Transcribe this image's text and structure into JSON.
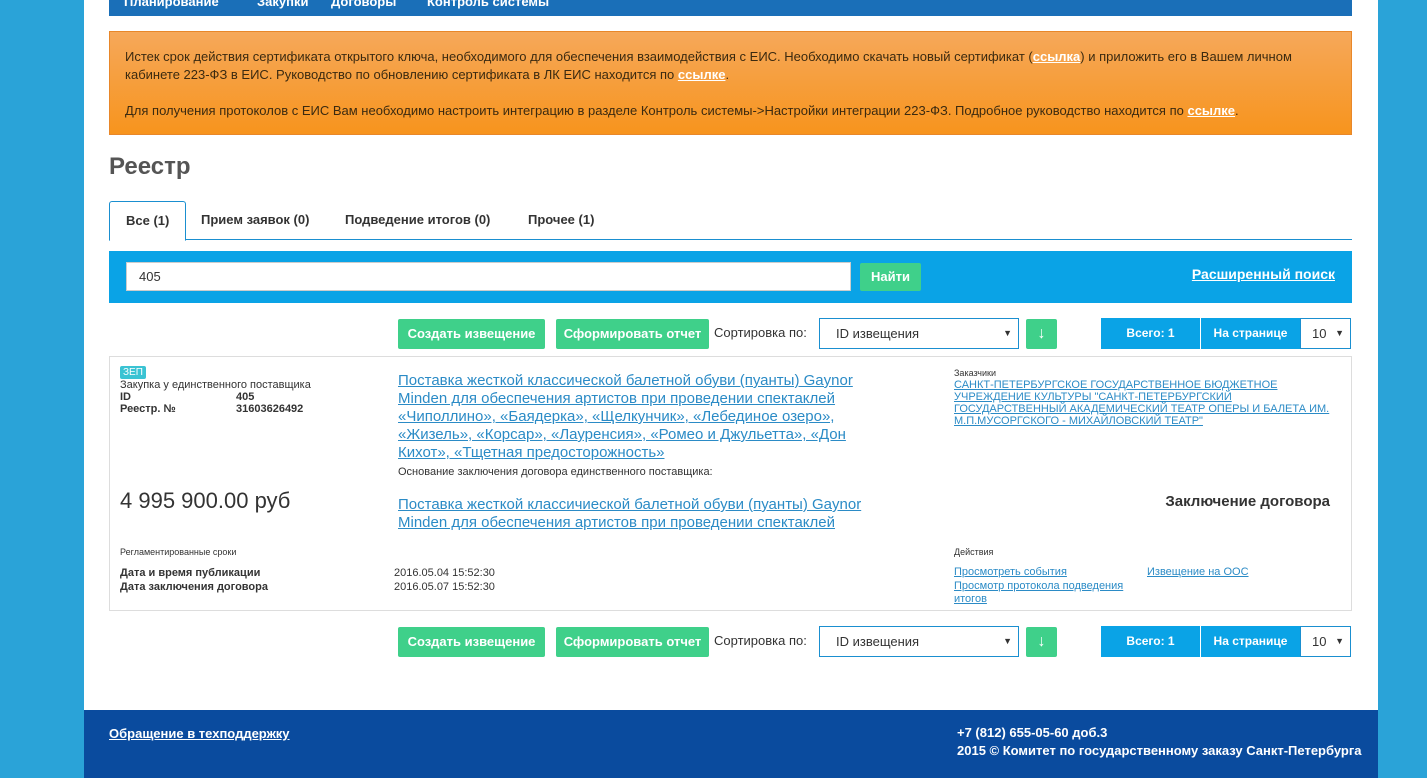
{
  "nav": {
    "items": [
      "Планирование",
      "Закупки",
      "Договоры",
      "Контроль системы"
    ]
  },
  "alert": {
    "p1_a": "Истек срок действия сертификата открытого ключа, необходимого для обеспечения взаимодействия с ЕИС. Необходимо скачать новый сертификат (",
    "p1_link1": "ссылка",
    "p1_b": ") и приложить его в Вашем личном кабинете 223-ФЗ в ЕИС. Руководство по обновлению сертификата в ЛК ЕИС находится по ",
    "p1_link2": "ссылке",
    "p1_c": ".",
    "p2_a": "Для получения протоколов с ЕИС Вам необходимо настроить интеграцию в разделе Контроль системы->Настройки интеграции 223-ФЗ. Подробное руководство находится по ",
    "p2_link": "ссылке",
    "p2_b": "."
  },
  "page_title": "Реестр",
  "tabs": [
    "Все (1)",
    "Прием заявок (0)",
    "Подведение итогов (0)",
    "Прочее (1)"
  ],
  "search": {
    "value": "405",
    "button": "Найти",
    "advanced": "Расширенный поиск"
  },
  "toolbar": {
    "create": "Создать извещение",
    "report": "Сформировать отчет",
    "sort_label": "Сортировка по:",
    "sort_value": "ID извещения",
    "sort_dir": "↓",
    "total": "Всего: 1",
    "per_page_label": "На странице",
    "per_page_value": "10"
  },
  "card": {
    "badge": "ЗЕП",
    "type": "Закупка у единственного поставщика",
    "id_label": "ID",
    "id_value": "405",
    "reg_label": "Реестр. №",
    "reg_value": "31603626492",
    "title": "Поставка жесткой классической балетной обуви (пуанты) Gaynor Minden для обеспечения артистов при проведении спектаклей «Чиполлино», «Баядерка», «Щелкунчик», «Лебединое озеро», «Жизель», «Корсар», «Лауренсия», «Ромео и Джульетта», «Дон Кихот», «Тщетная предосторожность»",
    "basis_label": "Основание заключения договора единственного поставщика:",
    "basis_title": "Поставка жесткой классичиеской балетной обуви (пуанты) Gaynor Minden для обеспечения артистов при проведении спектаклей",
    "price": "4 995 900.00 руб",
    "customers_label": "Заказчики",
    "customer": "САНКТ-ПЕТЕРБУРГСКОЕ ГОСУДАРСТВЕННОЕ БЮДЖЕТНОЕ УЧРЕЖДЕНИЕ КУЛЬТУРЫ \"САНКТ-ПЕТЕРБУРГСКИЙ ГОСУДАРСТВЕННЫЙ АКАДЕМИЧЕСКИЙ ТЕАТР ОПЕРЫ И БАЛЕТА ИМ. М.П.МУСОРГСКОГО - МИХАЙЛОВСКИЙ ТЕАТР\"",
    "status": "Заключение договора",
    "terms_label": "Регламентированные сроки",
    "pub_label": "Дата и время публикации",
    "pub_value": "2016.05.04 15:52:30",
    "contract_label": "Дата заключения договора",
    "contract_value": "2016.05.07 15:52:30",
    "actions_label": "Действия",
    "action_events": "Просмотреть события",
    "action_protocol": "Просмотр протокола подведения итогов",
    "action_oos": "Извещение на ООС"
  },
  "footer": {
    "support": "Обращение в техподдержку",
    "phone": "+7 (812) 655-05-60 доб.3",
    "copyright": "2015 © Комитет по государственному заказу Санкт-Петербурга"
  }
}
